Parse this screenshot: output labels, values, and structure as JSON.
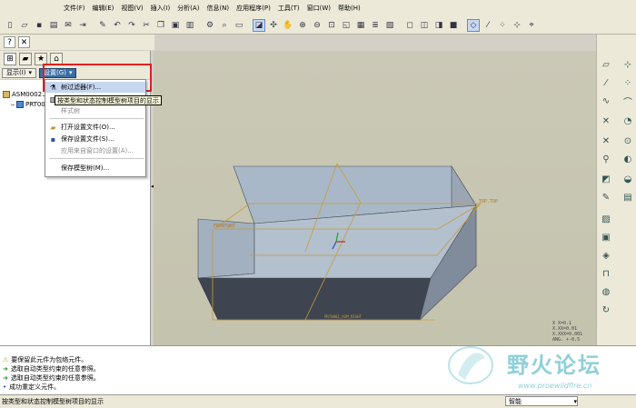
{
  "menubar": {
    "items": [
      "文件(F)",
      "编辑(E)",
      "视图(V)",
      "插入(I)",
      "分析(A)",
      "信息(N)",
      "应用程序(P)",
      "工具(T)",
      "窗口(W)",
      "帮助(H)"
    ]
  },
  "navigator": {
    "show_label": "显示(I)",
    "settings_label": "设置(G)",
    "tree": [
      {
        "label": "ASM0002.A",
        "icon": "assembly-icon"
      },
      {
        "label": "PRT000",
        "icon": "part-icon"
      }
    ]
  },
  "settings_menu": {
    "items": [
      {
        "label": "树过滤器(F)...",
        "icon": "filter-icon",
        "state": "highlighted"
      },
      {
        "label": "树列",
        "icon": "columns-icon",
        "state": "partially-hidden"
      },
      {
        "label": "样式树",
        "icon": "",
        "state": "disabled"
      },
      {
        "label": "打开设置文件(O)...",
        "icon": "open-folder-icon",
        "state": "enabled"
      },
      {
        "label": "保存设置文件(S)...",
        "icon": "save-icon",
        "state": "enabled"
      },
      {
        "label": "应用来自窗口的设置(A)...",
        "icon": "",
        "state": "disabled"
      },
      {
        "label": "保存模型树(M)...",
        "icon": "",
        "state": "enabled"
      }
    ]
  },
  "tooltip": "按类型和状态控制模型树项目的显示",
  "model": {
    "labels": {
      "front": "FRONT@NT",
      "top": "TOP.TOP",
      "bottom": "PRT0001_ASM_RIGHT"
    },
    "scale_lines": [
      "X X=0.1",
      "X.XX=0.01",
      "X.XXX=0.001",
      "ANG. +-0.5"
    ]
  },
  "messages": [
    {
      "icon": "warning-icon",
      "text": "要保留此元件为包络元件。"
    },
    {
      "icon": "arrow-icon",
      "text": "选取自动类型约束的任意参照。"
    },
    {
      "icon": "arrow-icon",
      "text": "选取自动类型约束的任意参照。"
    },
    {
      "icon": "dot-icon",
      "text": "成功重定义元件。"
    }
  ],
  "status": {
    "text": "按类型和状态控制模型树项目的显示",
    "filter_value": "智能"
  },
  "watermark": {
    "title": "野火论坛",
    "url": "www.proewildfire.cn"
  },
  "colors": {
    "highlight_box": "#e02020",
    "menu_hover": "#c6d7f0",
    "model_top": "#a9b8c8",
    "model_side": "#3e4550",
    "datum": "#c89a3a"
  }
}
